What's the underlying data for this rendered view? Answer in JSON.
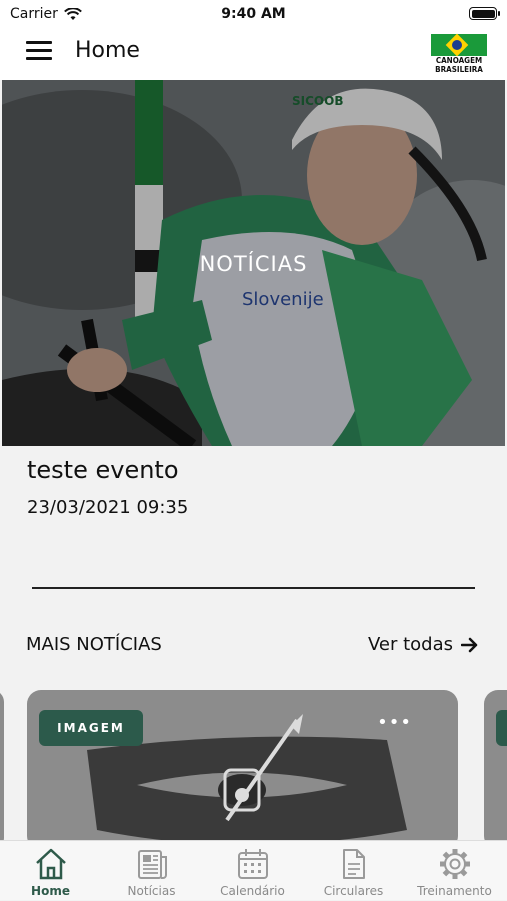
{
  "status_bar": {
    "carrier": "Carrier",
    "time": "9:40 AM"
  },
  "header": {
    "title": "Home",
    "logo_text_top": "CANOAGEM",
    "logo_text_bottom": "BRASILEIRA"
  },
  "hero": {
    "label": "NOTÍCIAS",
    "bib_text": "Slovenije",
    "helmet_text": "SICOOB"
  },
  "event": {
    "title": "teste evento",
    "date": "23/03/2021 09:35"
  },
  "more_news": {
    "label": "MAIS NOTÍCIAS",
    "see_all": "Ver todas",
    "see_all_icon": "arrow-right-icon"
  },
  "cards": [
    {
      "badge": "IMAGEM",
      "menu": "•••"
    }
  ],
  "tabs": [
    {
      "label": "Home",
      "icon": "home-icon",
      "active": true
    },
    {
      "label": "Notícias",
      "icon": "newspaper-icon",
      "active": false
    },
    {
      "label": "Calendário",
      "icon": "calendar-icon",
      "active": false
    },
    {
      "label": "Circulares",
      "icon": "document-icon",
      "active": false
    },
    {
      "label": "Treinamento",
      "icon": "gear-icon",
      "active": false
    }
  ],
  "colors": {
    "accent": "#2e5a4a",
    "badge": "#2c5a4b",
    "tab_inactive": "#8a8a8a",
    "logo_green": "#1a9a3a",
    "logo_yellow": "#ffd200"
  }
}
